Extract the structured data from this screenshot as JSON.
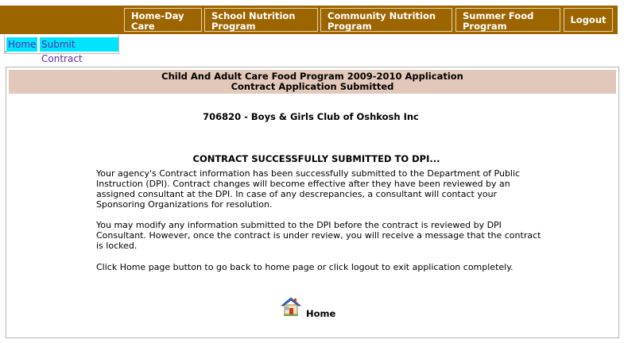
{
  "nav": {
    "home_day_care": [
      "Home-Day",
      "Care"
    ],
    "school_nutrition": [
      "School Nutrition",
      "Program"
    ],
    "community_nutrition": [
      "Community Nutrition",
      "Program"
    ],
    "summer_food": [
      "Summer Food",
      "Program"
    ],
    "logout": "Logout"
  },
  "breadcrumb": {
    "home": "Home",
    "submit_contract": "Submit Contract",
    "stray_mark": "`"
  },
  "panel": {
    "title_line1": "Child And Adult Care Food Program 2009-2010 Application",
    "title_line2": "Contract Application Submitted",
    "organization": "706820 - Boys & Girls Club of Oshkosh Inc",
    "success_message": "CONTRACT SUCCESSFULLY SUBMITTED TO DPI...",
    "paragraph1": "Your agency's Contract information has been successfully submitted to the Department of Public Instruction (DPI). Contract changes will become effective after they have been reviewed by an assigned consultant at the DPI. In case of any descrepancies, a consultant will contact your Sponsoring Organizations for resolution.",
    "paragraph2": "You may modify any information submitted to the DPI before the contract is reviewed by DPI Consultant. However, once the contract is under review, you will receive a message that the contract is locked.",
    "paragraph3": "Click Home page button to go back to home page or click logout to exit application completely.",
    "home_button_label": "Home"
  },
  "colors": {
    "nav_background": "#9c6500",
    "header_background": "#e2c8ba",
    "breadcrumb_background": "#00e5ff",
    "breadcrumb_text": "#5a2ca8"
  }
}
